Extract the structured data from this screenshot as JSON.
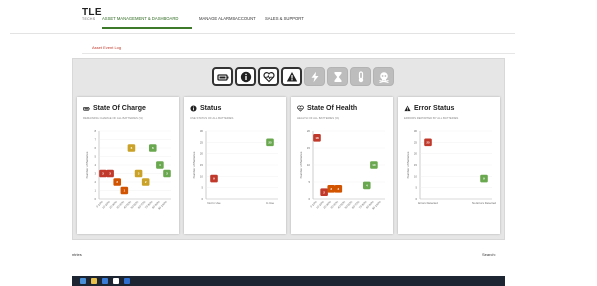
{
  "logo": {
    "main": "TLE",
    "sub": "TECHS"
  },
  "nav": {
    "items": [
      "ASSET MANAGEMENT & DASHBOARD",
      "MANAGE ALARMS",
      "ACCOUNT",
      "SALES & SUPPORT"
    ]
  },
  "breadcrumb": "Asset Event Log",
  "toolbar": {
    "buttons": [
      {
        "icon": "battery-icon",
        "active": true
      },
      {
        "icon": "info-icon",
        "active": true
      },
      {
        "icon": "heart-pulse-icon",
        "active": true
      },
      {
        "icon": "warning-icon",
        "active": true
      },
      {
        "icon": "lightning-icon",
        "active": false
      },
      {
        "icon": "hourglass-icon",
        "active": false
      },
      {
        "icon": "thermometer-icon",
        "active": false
      },
      {
        "icon": "skull-icon",
        "active": false
      }
    ]
  },
  "colors": {
    "red": "#c0392b",
    "orange": "#d35400",
    "yellow": "#c9a227",
    "green": "#6aa84f",
    "accent": "#3d7a2a"
  },
  "cards": [
    {
      "title": "State Of Charge",
      "subtitle": "REMAINING CHARGE OF ALL BATTERIES (%)",
      "icon": "battery-icon"
    },
    {
      "title": "Status",
      "subtitle": "USE STATUS OF ALL BATTERIES",
      "icon": "info-icon"
    },
    {
      "title": "State Of Health",
      "subtitle": "HEALTH OF ALL BATTERIES (%)",
      "icon": "heart-pulse-icon"
    },
    {
      "title": "Error Status",
      "subtitle": "ERRORS REPORTED BY ALL BATTERIES",
      "icon": "warning-icon"
    }
  ],
  "chart_data": [
    {
      "type": "scatter",
      "title": "State Of Charge",
      "ylabel": "Number of Batteries",
      "ylim": [
        0,
        8
      ],
      "yticks": [
        0,
        1,
        2,
        3,
        4,
        5,
        6,
        7,
        8
      ],
      "categories": [
        "0-10%",
        "10-20%",
        "20-30%",
        "30-40%",
        "40-50%",
        "50-60%",
        "60-70%",
        "70-80%",
        "80-90%",
        "90-100%"
      ],
      "points": [
        {
          "cat": 0,
          "value": 3,
          "color": "red"
        },
        {
          "cat": 1,
          "value": 3,
          "color": "red"
        },
        {
          "cat": 2,
          "value": 2,
          "color": "orange"
        },
        {
          "cat": 3,
          "value": 1,
          "color": "orange"
        },
        {
          "cat": 4,
          "value": 6,
          "color": "yellow"
        },
        {
          "cat": 5,
          "value": 3,
          "color": "yellow"
        },
        {
          "cat": 6,
          "value": 2,
          "color": "yellow"
        },
        {
          "cat": 7,
          "value": 6,
          "color": "green"
        },
        {
          "cat": 8,
          "value": 4,
          "color": "green"
        },
        {
          "cat": 9,
          "value": 3,
          "color": "green"
        }
      ]
    },
    {
      "type": "scatter",
      "title": "Status",
      "ylabel": "Number of Batteries",
      "ylim": [
        0,
        30
      ],
      "yticks": [
        0,
        5,
        10,
        15,
        20,
        25,
        30
      ],
      "categories": [
        "Not In Use",
        "In Use"
      ],
      "points": [
        {
          "cat": 0,
          "value": 9,
          "color": "red"
        },
        {
          "cat": 1,
          "value": 25,
          "color": "green"
        }
      ]
    },
    {
      "type": "scatter",
      "title": "State Of Health",
      "ylabel": "Number of Batteries",
      "ylim": [
        0,
        20
      ],
      "yticks": [
        0,
        5,
        10,
        15,
        20
      ],
      "categories": [
        "0-10%",
        "10-20%",
        "20-30%",
        "30-40%",
        "40-50%",
        "50-60%",
        "60-70%",
        "70-80%",
        "80-90%",
        "90-100%"
      ],
      "points": [
        {
          "cat": 0,
          "value": 18,
          "color": "red"
        },
        {
          "cat": 1,
          "value": 2,
          "color": "red"
        },
        {
          "cat": 2,
          "value": 3,
          "color": "orange"
        },
        {
          "cat": 3,
          "value": 3,
          "color": "orange"
        },
        {
          "cat": 7,
          "value": 4,
          "color": "green"
        },
        {
          "cat": 8,
          "value": 10,
          "color": "green"
        }
      ]
    },
    {
      "type": "scatter",
      "title": "Error Status",
      "ylabel": "Number of Batteries",
      "ylim": [
        0,
        30
      ],
      "yticks": [
        0,
        5,
        10,
        15,
        20,
        25,
        30
      ],
      "categories": [
        "Errors Detected",
        "No Errors Detected"
      ],
      "points": [
        {
          "cat": 0,
          "value": 25,
          "color": "red"
        },
        {
          "cat": 1,
          "value": 9,
          "color": "green"
        }
      ]
    }
  ],
  "table": {
    "entries_label": "Show",
    "entries_suffix": "ntries",
    "search_label": "Search:"
  },
  "taskbar": {
    "icons": [
      "start-icon",
      "file-explorer-icon",
      "store-icon",
      "browser-icon",
      "mail-icon"
    ]
  }
}
